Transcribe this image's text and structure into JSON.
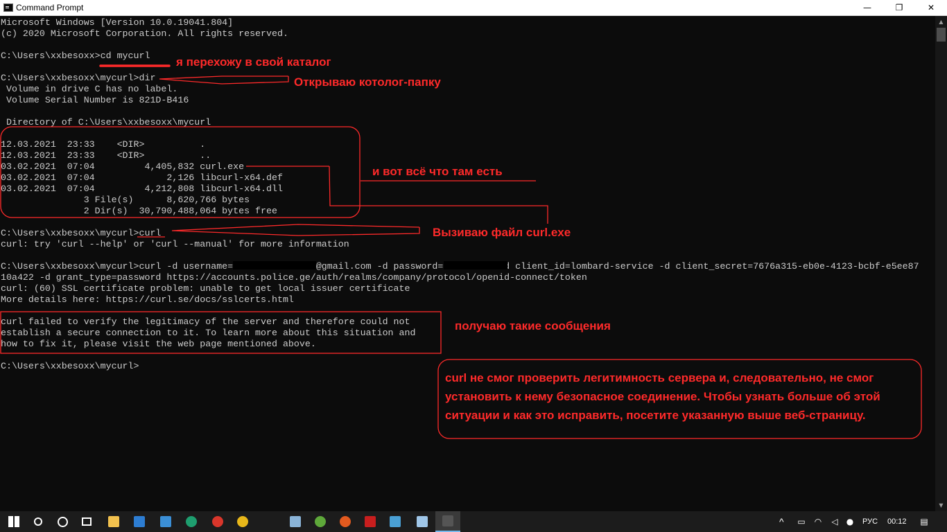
{
  "window": {
    "title": "Command Prompt",
    "minimize_glyph": "—",
    "maximize_glyph": "❐",
    "close_glyph": "✕"
  },
  "console": {
    "lines": [
      "Microsoft Windows [Version 10.0.19041.804]",
      "(c) 2020 Microsoft Corporation. All rights reserved.",
      "",
      "C:\\Users\\xxbesoxx>cd mycurl",
      "",
      "C:\\Users\\xxbesoxx\\mycurl>dir",
      " Volume in drive C has no label.",
      " Volume Serial Number is 821D-B416",
      "",
      " Directory of C:\\Users\\xxbesoxx\\mycurl",
      "",
      "12.03.2021  23:33    <DIR>          .",
      "12.03.2021  23:33    <DIR>          ..",
      "03.02.2021  07:04         4,405,832 curl.exe",
      "03.02.2021  07:04             2,126 libcurl-x64.def",
      "03.02.2021  07:04         4,212,808 libcurl-x64.dll",
      "               3 File(s)      8,620,766 bytes",
      "               2 Dir(s)  30,790,488,064 bytes free",
      "",
      "C:\\Users\\xxbesoxx\\mycurl>curl",
      "curl: try 'curl --help' or 'curl --manual' for more information",
      "",
      "C:\\Users\\xxbesoxx\\mycurl>curl -d username=               @gmail.com -d password=          -d client_id=lombard-service -d client_secret=7676a315-eb0e-4123-bcbf-e5ee87",
      "10a422 -d grant_type=password https://accounts.police.ge/auth/realms/company/protocol/openid-connect/token",
      "curl: (60) SSL certificate problem: unable to get local issuer certificate",
      "More details here: https://curl.se/docs/sslcerts.html",
      "",
      "curl failed to verify the legitimacy of the server and therefore could not",
      "establish a secure connection to it. To learn more about this situation and",
      "how to fix it, please visit the web page mentioned above.",
      "",
      "C:\\Users\\xxbesoxx\\mycurl>"
    ]
  },
  "annotations": {
    "a1": "я перехожу в свой каталог",
    "a2": "Открываю котолог-папку",
    "a3": "и вот всё что там есть",
    "a4": "Вызиваю файл curl.exe",
    "a5": "получаю такие сообщения",
    "a6": "curl не смог проверить легитимность сервера и, следовательно, не смог установить к нему безопасное соединение. Чтобы узнать больше об этой ситуации и как это исправить, посетите указанную выше веб-страницу."
  },
  "taskbar": {
    "icons": [
      "start-icon",
      "search-icon",
      "cortana-icon",
      "task-view-icon",
      "file-explorer-icon",
      "store-icon",
      "mail-icon",
      "edge-icon",
      "app-red-icon",
      "chrome-icon",
      "tools-icon",
      "utorrent-icon",
      "app-orange-icon",
      "acrobat-icon",
      "app-blue-icon",
      "notepad-icon",
      "cmd-icon"
    ],
    "language": "РУС",
    "time": "00:12"
  },
  "colors": {
    "console_bg": "#0c0c0c",
    "console_text": "#cccccc",
    "annotation": "#ff2a2a"
  }
}
